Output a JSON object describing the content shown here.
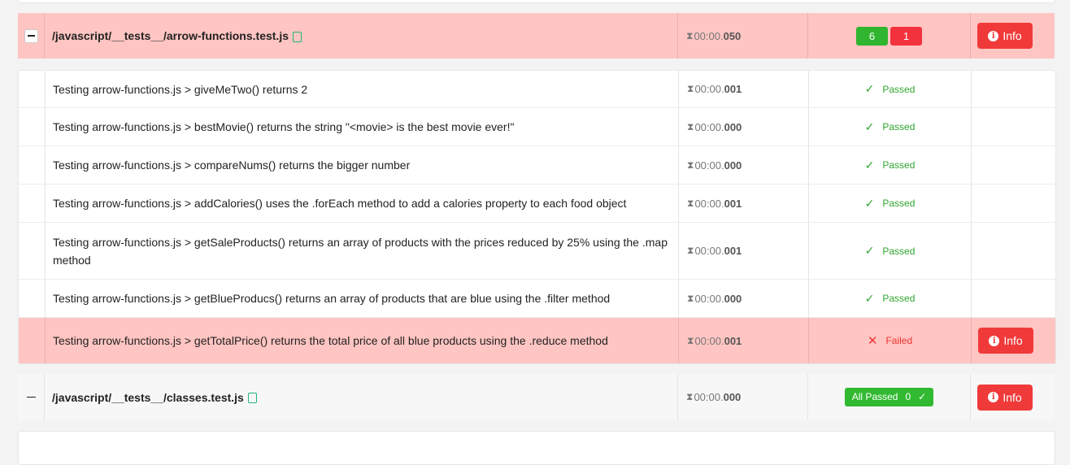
{
  "files": [
    {
      "path": "/javascript/__tests__/arrow-functions.test.js",
      "duration_prefix": "00:00.",
      "duration_ms": "050",
      "passed_count": "6",
      "failed_count": "1",
      "info_label": "Info"
    },
    {
      "path": "/javascript/__tests__/classes.test.js",
      "duration_prefix": "00:00.",
      "duration_ms": "000",
      "all_passed_label": "All Passed",
      "all_passed_count": "0",
      "info_label": "Info"
    }
  ],
  "tests": [
    {
      "name": "Testing arrow-functions.js > giveMeTwo() returns 2",
      "duration_prefix": "00:00.",
      "duration_ms": "001",
      "status": "Passed"
    },
    {
      "name": "Testing arrow-functions.js > bestMovie() returns the string \"<movie> is the best movie ever!\"",
      "duration_prefix": "00:00.",
      "duration_ms": "000",
      "status": "Passed"
    },
    {
      "name": "Testing arrow-functions.js > compareNums() returns the bigger number",
      "duration_prefix": "00:00.",
      "duration_ms": "000",
      "status": "Passed"
    },
    {
      "name": "Testing arrow-functions.js > addCalories() uses the .forEach method to add a calories property to each food object",
      "duration_prefix": "00:00.",
      "duration_ms": "001",
      "status": "Passed"
    },
    {
      "name": "Testing arrow-functions.js > getSaleProducts() returns an array of products with the prices reduced by 25% using the .map method",
      "duration_prefix": "00:00.",
      "duration_ms": "001",
      "status": "Passed"
    },
    {
      "name": "Testing arrow-functions.js > getBlueProducs() returns an array of products that are blue using the .filter method",
      "duration_prefix": "00:00.",
      "duration_ms": "000",
      "status": "Passed"
    },
    {
      "name": "Testing arrow-functions.js > getTotalPrice() returns the total price of all blue products using the .reduce method",
      "duration_prefix": "00:00.",
      "duration_ms": "001",
      "status": "Failed",
      "info_label": "Info"
    }
  ],
  "icons": {
    "hourglass": "hourglass-icon",
    "copy": "copy-icon",
    "check": "check-icon",
    "cross": "cross-icon",
    "info": "info-icon"
  },
  "colors": {
    "fail_row_bg": "#ffc5c2",
    "pass_green": "#2fb52f",
    "fail_red": "#f2323d"
  }
}
